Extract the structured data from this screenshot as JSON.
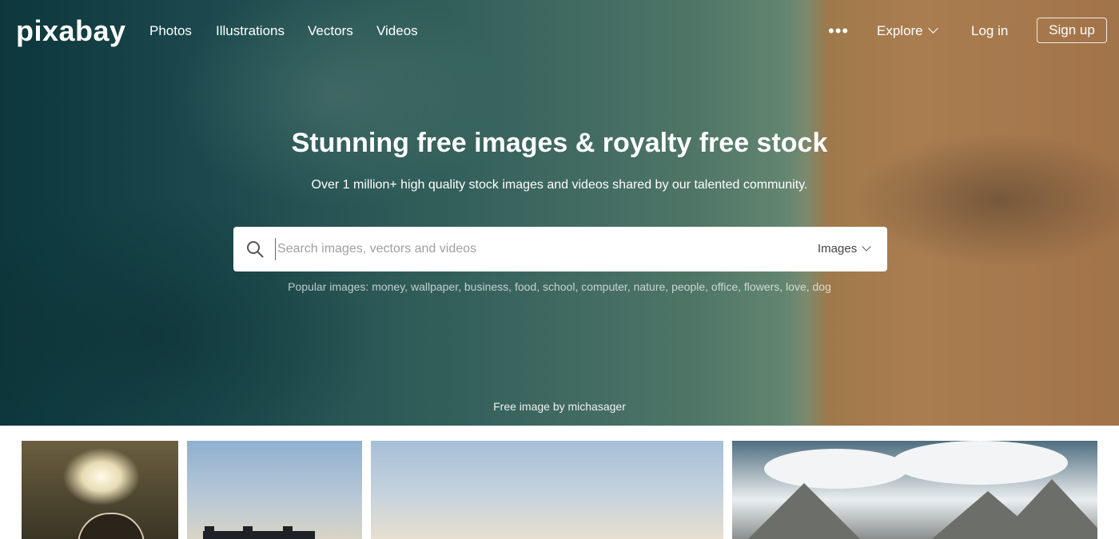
{
  "header": {
    "logo": "pixabay",
    "nav": [
      {
        "label": "Photos"
      },
      {
        "label": "Illustrations"
      },
      {
        "label": "Vectors"
      },
      {
        "label": "Videos"
      }
    ],
    "more_label": "•••",
    "explore_label": "Explore",
    "login_label": "Log in",
    "signup_label": "Sign up"
  },
  "hero": {
    "title": "Stunning free images & royalty free stock",
    "subtitle": "Over 1 million+ high quality stock images and videos shared by our talented community.",
    "search": {
      "placeholder": "Search images, vectors and videos",
      "value": "",
      "type_selected": "Images"
    },
    "popular_label": "Popular images:",
    "popular_tags": [
      "money",
      "wallpaper",
      "business",
      "food",
      "school",
      "computer",
      "nature",
      "people",
      "office",
      "flowers",
      "love",
      "dog"
    ],
    "credit": "Free image by michasager"
  },
  "gallery": {
    "thumbnails": 4
  },
  "colors": {
    "hero_water": "#2e6a66",
    "hero_sand": "#c28f5c",
    "text_white": "#ffffff"
  }
}
